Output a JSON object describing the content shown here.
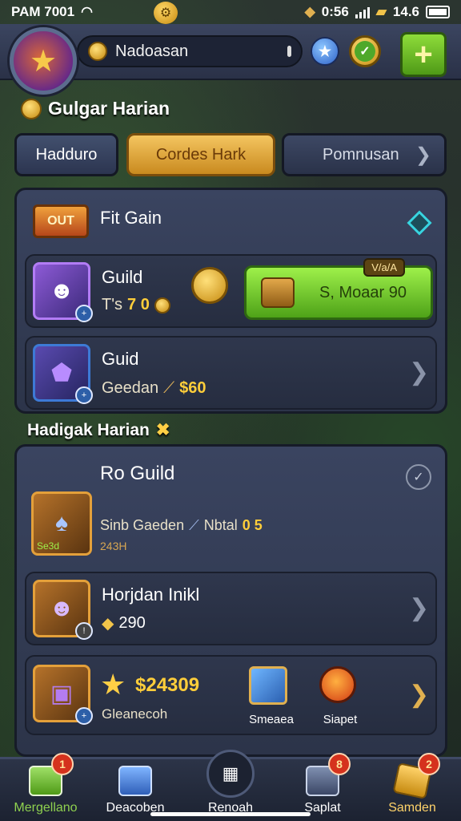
{
  "status_bar": {
    "left_text": "PAM  7001",
    "time": "0:56",
    "right_text": "14.6"
  },
  "header": {
    "player_name": "Nadoasan",
    "plus_label": "+"
  },
  "section1": {
    "title": "Gulgar Harian"
  },
  "tabs": [
    {
      "label": "Hadduro"
    },
    {
      "label": "Cordes Hark"
    },
    {
      "label": "Pomnusan"
    }
  ],
  "panel1": {
    "badge": "OUT",
    "title": "Fit Gain",
    "row1": {
      "title": "Guild",
      "sub_prefix": "T's",
      "sub_value": "7 0",
      "button_label": "S, Moaar 90",
      "button_tag": "V/a/A"
    },
    "row2": {
      "title": "Guid",
      "sub_prefix": "Geedan",
      "sub_value": "$60"
    }
  },
  "section2": {
    "title": "Hadigak Harian"
  },
  "panel2": {
    "header_title": "Ro  Guild",
    "header_sub_prefix": "Sinb Gaeden",
    "header_sub_mid": "Nbtal",
    "header_sub_value": "0 5",
    "header_note": "243H",
    "portrait_caption": "Se3d",
    "row1": {
      "title": "Horjdan Inikl",
      "value": "290"
    },
    "row2": {
      "value": "$24309",
      "caption": "Gleanecoh",
      "item1_label": "Smeaea",
      "item2_label": "Siapet"
    }
  },
  "bottom_nav": [
    {
      "label": "Mergellano",
      "badge": "1",
      "icon": "house-icon",
      "color": "#8fd14f"
    },
    {
      "label": "Deacoben",
      "badge": "",
      "icon": "house-blue-icon",
      "color": "#ffffff"
    },
    {
      "label": "Renoah",
      "badge": "",
      "icon": "grid-icon",
      "color": "#ffffff"
    },
    {
      "label": "Saplat",
      "badge": "8",
      "icon": "box-icon",
      "color": "#ffffff"
    },
    {
      "label": "Samden",
      "badge": "2",
      "icon": "gem-icon",
      "color": "#ffd36a"
    }
  ]
}
